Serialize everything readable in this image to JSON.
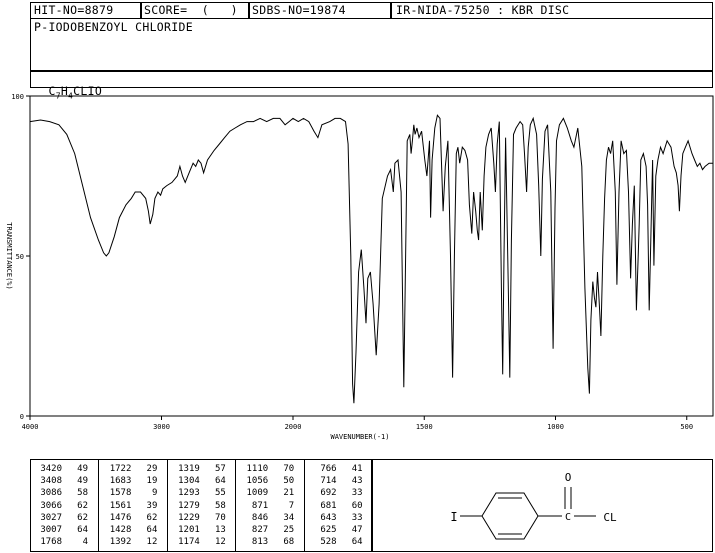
{
  "header": {
    "hit_no": "HIT-NO=8879",
    "score": "SCORE=  (   )",
    "sdbs_no": "SDBS-NO=19874",
    "ir_code": "IR-NIDA-75250 : KBR DISC",
    "compound_name": "P-IODOBENZOYL CHLORIDE",
    "formula": {
      "c": "C",
      "c_n": "7",
      "h": "H",
      "h_n": "4",
      "rest": "CLIO"
    }
  },
  "chart_data": {
    "type": "line",
    "xlabel": "WAVENUMBER(-1)",
    "ylabel": "TRANSMITTANCE(%)",
    "xlim": [
      4000,
      400
    ],
    "ylim": [
      0,
      100
    ],
    "x_ticks": [
      4000,
      3000,
      2000,
      1500,
      1000,
      500
    ],
    "y_ticks": [
      0,
      50,
      100
    ],
    "series": [
      {
        "points": [
          [
            4000,
            92
          ],
          [
            3920,
            92.5
          ],
          [
            3850,
            92
          ],
          [
            3780,
            91
          ],
          [
            3720,
            88
          ],
          [
            3660,
            82
          ],
          [
            3600,
            72
          ],
          [
            3540,
            62
          ],
          [
            3480,
            55
          ],
          [
            3440,
            51
          ],
          [
            3420,
            50
          ],
          [
            3400,
            51
          ],
          [
            3360,
            56
          ],
          [
            3320,
            62
          ],
          [
            3270,
            66
          ],
          [
            3230,
            68
          ],
          [
            3200,
            70
          ],
          [
            3160,
            70
          ],
          [
            3120,
            68
          ],
          [
            3100,
            64
          ],
          [
            3086,
            60
          ],
          [
            3066,
            63
          ],
          [
            3050,
            68
          ],
          [
            3027,
            70
          ],
          [
            3007,
            69
          ],
          [
            2990,
            71
          ],
          [
            2960,
            72
          ],
          [
            2920,
            73
          ],
          [
            2880,
            75
          ],
          [
            2860,
            78
          ],
          [
            2840,
            75
          ],
          [
            2820,
            73
          ],
          [
            2790,
            76
          ],
          [
            2760,
            79
          ],
          [
            2740,
            78
          ],
          [
            2720,
            80
          ],
          [
            2700,
            79
          ],
          [
            2680,
            76
          ],
          [
            2650,
            80
          ],
          [
            2600,
            83
          ],
          [
            2560,
            85
          ],
          [
            2520,
            87
          ],
          [
            2480,
            89
          ],
          [
            2440,
            90
          ],
          [
            2400,
            91
          ],
          [
            2350,
            92
          ],
          [
            2300,
            92
          ],
          [
            2250,
            93
          ],
          [
            2200,
            92
          ],
          [
            2150,
            93
          ],
          [
            2100,
            93
          ],
          [
            2060,
            91
          ],
          [
            2030,
            92
          ],
          [
            2000,
            93
          ],
          [
            1980,
            92
          ],
          [
            1960,
            93
          ],
          [
            1940,
            92
          ],
          [
            1920,
            89
          ],
          [
            1905,
            87
          ],
          [
            1890,
            91
          ],
          [
            1860,
            92
          ],
          [
            1840,
            93
          ],
          [
            1820,
            93
          ],
          [
            1800,
            92
          ],
          [
            1790,
            85
          ],
          [
            1780,
            50
          ],
          [
            1773,
            10
          ],
          [
            1768,
            4
          ],
          [
            1760,
            20
          ],
          [
            1750,
            45
          ],
          [
            1740,
            52
          ],
          [
            1730,
            40
          ],
          [
            1722,
            29
          ],
          [
            1715,
            43
          ],
          [
            1705,
            45
          ],
          [
            1695,
            35
          ],
          [
            1683,
            19
          ],
          [
            1672,
            35
          ],
          [
            1660,
            68
          ],
          [
            1640,
            75
          ],
          [
            1628,
            77
          ],
          [
            1618,
            70
          ],
          [
            1612,
            79
          ],
          [
            1600,
            80
          ],
          [
            1588,
            70
          ],
          [
            1578,
            9
          ],
          [
            1572,
            45
          ],
          [
            1565,
            86
          ],
          [
            1555,
            88
          ],
          [
            1550,
            82
          ],
          [
            1545,
            86
          ],
          [
            1540,
            91
          ],
          [
            1535,
            88
          ],
          [
            1528,
            90
          ],
          [
            1520,
            87
          ],
          [
            1510,
            89
          ],
          [
            1498,
            80
          ],
          [
            1490,
            75
          ],
          [
            1480,
            86
          ],
          [
            1476,
            62
          ],
          [
            1470,
            80
          ],
          [
            1460,
            90
          ],
          [
            1450,
            94
          ],
          [
            1440,
            93
          ],
          [
            1428,
            64
          ],
          [
            1420,
            78
          ],
          [
            1410,
            86
          ],
          [
            1400,
            50
          ],
          [
            1392,
            12
          ],
          [
            1385,
            50
          ],
          [
            1378,
            82
          ],
          [
            1372,
            84
          ],
          [
            1365,
            79
          ],
          [
            1355,
            84
          ],
          [
            1345,
            83
          ],
          [
            1335,
            80
          ],
          [
            1328,
            66
          ],
          [
            1319,
            57
          ],
          [
            1312,
            70
          ],
          [
            1304,
            64
          ],
          [
            1298,
            58
          ],
          [
            1293,
            55
          ],
          [
            1287,
            70
          ],
          [
            1279,
            58
          ],
          [
            1272,
            75
          ],
          [
            1265,
            84
          ],
          [
            1255,
            88
          ],
          [
            1245,
            90
          ],
          [
            1235,
            79
          ],
          [
            1229,
            70
          ],
          [
            1222,
            85
          ],
          [
            1214,
            92
          ],
          [
            1206,
            40
          ],
          [
            1201,
            13
          ],
          [
            1196,
            50
          ],
          [
            1190,
            87
          ],
          [
            1180,
            40
          ],
          [
            1174,
            12
          ],
          [
            1168,
            55
          ],
          [
            1160,
            88
          ],
          [
            1150,
            90
          ],
          [
            1135,
            92
          ],
          [
            1125,
            91
          ],
          [
            1118,
            82
          ],
          [
            1110,
            70
          ],
          [
            1104,
            84
          ],
          [
            1096,
            91
          ],
          [
            1085,
            93
          ],
          [
            1072,
            88
          ],
          [
            1064,
            72
          ],
          [
            1056,
            50
          ],
          [
            1050,
            74
          ],
          [
            1040,
            89
          ],
          [
            1030,
            91
          ],
          [
            1018,
            70
          ],
          [
            1009,
            21
          ],
          [
            1002,
            65
          ],
          [
            996,
            86
          ],
          [
            985,
            91
          ],
          [
            970,
            93
          ],
          [
            955,
            90
          ],
          [
            940,
            86
          ],
          [
            930,
            84
          ],
          [
            915,
            90
          ],
          [
            900,
            78
          ],
          [
            888,
            40
          ],
          [
            877,
            15
          ],
          [
            871,
            7
          ],
          [
            865,
            30
          ],
          [
            858,
            42
          ],
          [
            852,
            37
          ],
          [
            846,
            34
          ],
          [
            840,
            45
          ],
          [
            833,
            35
          ],
          [
            827,
            25
          ],
          [
            820,
            50
          ],
          [
            813,
            68
          ],
          [
            806,
            80
          ],
          [
            798,
            84
          ],
          [
            790,
            82
          ],
          [
            782,
            86
          ],
          [
            772,
            70
          ],
          [
            766,
            41
          ],
          [
            758,
            70
          ],
          [
            750,
            86
          ],
          [
            740,
            82
          ],
          [
            730,
            83
          ],
          [
            722,
            70
          ],
          [
            714,
            43
          ],
          [
            707,
            60
          ],
          [
            700,
            72
          ],
          [
            692,
            33
          ],
          [
            685,
            50
          ],
          [
            681,
            60
          ],
          [
            675,
            80
          ],
          [
            665,
            82
          ],
          [
            655,
            78
          ],
          [
            649,
            66
          ],
          [
            643,
            33
          ],
          [
            637,
            55
          ],
          [
            630,
            80
          ],
          [
            625,
            47
          ],
          [
            618,
            75
          ],
          [
            610,
            80
          ],
          [
            600,
            84
          ],
          [
            590,
            82
          ],
          [
            575,
            86
          ],
          [
            560,
            84
          ],
          [
            548,
            78
          ],
          [
            540,
            76
          ],
          [
            533,
            72
          ],
          [
            528,
            64
          ],
          [
            522,
            75
          ],
          [
            515,
            82
          ],
          [
            505,
            84
          ],
          [
            495,
            86
          ],
          [
            480,
            82
          ],
          [
            470,
            80
          ],
          [
            460,
            78
          ],
          [
            450,
            79
          ],
          [
            440,
            77
          ],
          [
            430,
            78
          ],
          [
            415,
            79
          ],
          [
            400,
            79
          ]
        ]
      }
    ],
    "peak_table": [
      [
        [
          3420,
          49
        ],
        [
          3408,
          49
        ],
        [
          3086,
          58
        ],
        [
          3066,
          62
        ],
        [
          3027,
          62
        ],
        [
          3007,
          64
        ],
        [
          1768,
          4
        ]
      ],
      [
        [
          1722,
          29
        ],
        [
          1683,
          19
        ],
        [
          1578,
          9
        ],
        [
          1561,
          39
        ],
        [
          1476,
          62
        ],
        [
          1428,
          64
        ],
        [
          1392,
          12
        ]
      ],
      [
        [
          1319,
          57
        ],
        [
          1304,
          64
        ],
        [
          1293,
          55
        ],
        [
          1279,
          58
        ],
        [
          1229,
          70
        ],
        [
          1201,
          13
        ],
        [
          1174,
          12
        ]
      ],
      [
        [
          1110,
          70
        ],
        [
          1056,
          50
        ],
        [
          1009,
          21
        ],
        [
          871,
          7
        ],
        [
          846,
          34
        ],
        [
          827,
          25
        ],
        [
          813,
          68
        ]
      ],
      [
        [
          766,
          41
        ],
        [
          714,
          43
        ],
        [
          692,
          33
        ],
        [
          681,
          60
        ],
        [
          643,
          33
        ],
        [
          625,
          47
        ],
        [
          528,
          64
        ]
      ]
    ]
  },
  "structure": {
    "iodine": "I",
    "oxygen": "O",
    "chlorine": "CL"
  }
}
